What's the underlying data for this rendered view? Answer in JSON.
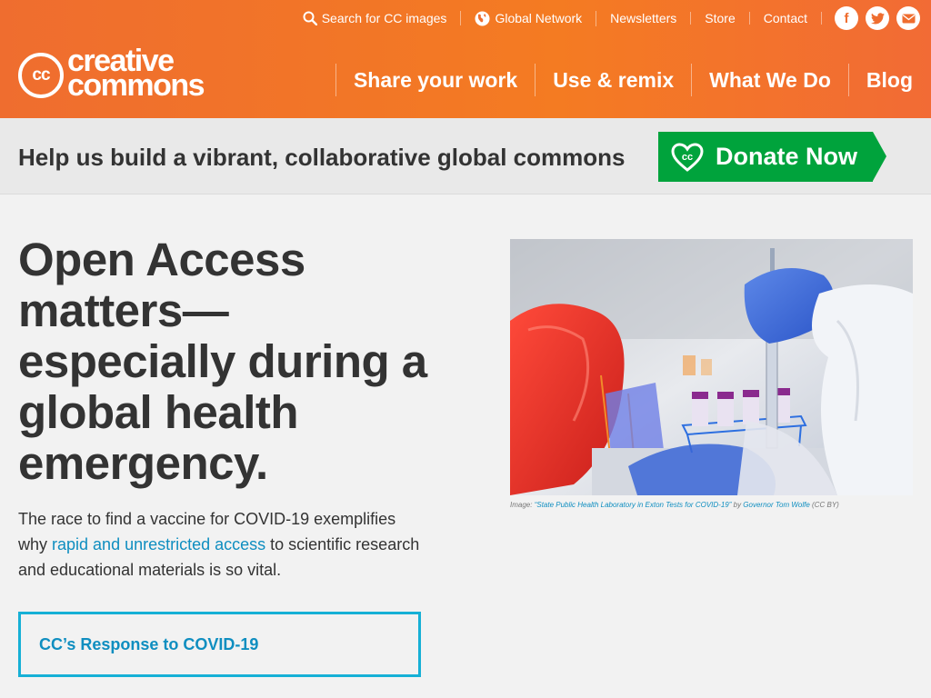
{
  "colors": {
    "header_orange": "#f47b22",
    "donate_green": "#00a33c",
    "link_blue": "#0f8ec0",
    "cta_border": "#16b0d6"
  },
  "utility_nav": {
    "search": "Search for CC images",
    "global": "Global Network",
    "newsletters": "Newsletters",
    "store": "Store",
    "contact": "Contact",
    "socials": [
      {
        "icon": "facebook-icon",
        "glyph": "f"
      },
      {
        "icon": "twitter-icon",
        "glyph": "t"
      },
      {
        "icon": "email-icon",
        "glyph": "✉"
      }
    ]
  },
  "logo": {
    "mark": "cc",
    "line1": "creative",
    "line2": "commons"
  },
  "main_nav": [
    "Share your work",
    "Use & remix",
    "What We Do",
    "Blog"
  ],
  "donate_bar": {
    "message": "Help us build a vibrant, collaborative global commons",
    "button": "Donate Now",
    "heart_mark": "cc"
  },
  "hero": {
    "headline": "Open Access matters—especially during a global health emergency.",
    "lead_before": "The race to find a vaccine for COVID-19 exemplifies why ",
    "lead_link": "rapid and unrestricted access",
    "lead_after": " to scientific research and educational materials is so vital.",
    "cta": "CC’s Response to COVID-19"
  },
  "image_caption": {
    "prefix": "Image: ",
    "title": "“State Public Health Laboratory in Exton Tests for COVID-19”",
    "by": " by ",
    "author": "Governor Tom Wolfe",
    "license": " (CC BY)"
  }
}
